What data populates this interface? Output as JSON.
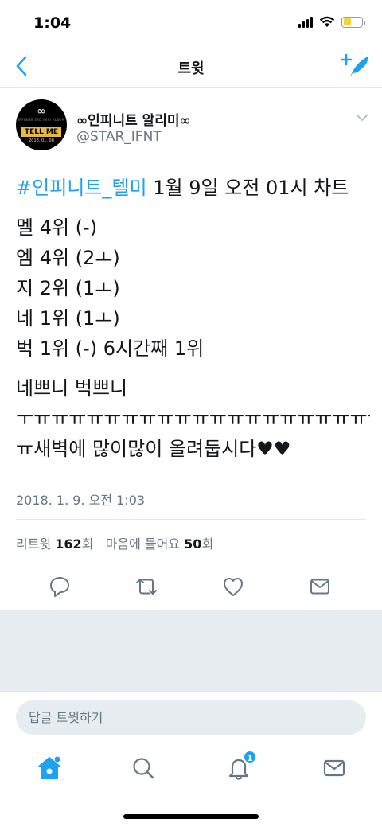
{
  "status_bar": {
    "time": "1:04"
  },
  "nav": {
    "title": "트윗"
  },
  "tweet": {
    "display_name": "∞인피니트 알리미∞",
    "handle": "@STAR_IFNT",
    "avatar": {
      "symbol": "∞",
      "small_text": "INFINITE 3RD MINI ALBUM",
      "banner": "TELL ME",
      "date": "2018. 01. 08"
    },
    "hashtag": "#인피니트_텔미",
    "headline_rest": " 1월 9일 오전 01시 차트",
    "lines": [
      "멜 4위 (-)",
      "엠 4위 (2ㅗ)",
      "지 2위 (1ㅗ)",
      "네 1위 (1ㅗ)",
      "벅 1위 (-) 6시간째 1위"
    ],
    "line_after": "네쁘니 벅쁘니",
    "line_long": "ㅜㅠㅠㅠㅠㅠㅠㅠㅠㅠㅠㅠㅠㅠㅠㅠㅠㅠㅠㅠㅠㅠㅠ",
    "line_last": "ㅠ새벽에 많이많이 올려둡시다♥♥",
    "timestamp": "2018. 1. 9. 오전 1:03"
  },
  "stats": {
    "retweets_label": "리트윗",
    "retweets_count": "162",
    "retweets_unit": "회",
    "likes_label": "마음에 들어요",
    "likes_count": "50",
    "likes_unit": "회"
  },
  "reply": {
    "placeholder": "답글 트윗하기"
  },
  "tabbar": {
    "notifications_badge": "1"
  },
  "colors": {
    "accent": "#1da1f2",
    "secondary_text": "#657786",
    "divider": "#e1e8ed",
    "gray_bg": "#e6ecf0"
  }
}
